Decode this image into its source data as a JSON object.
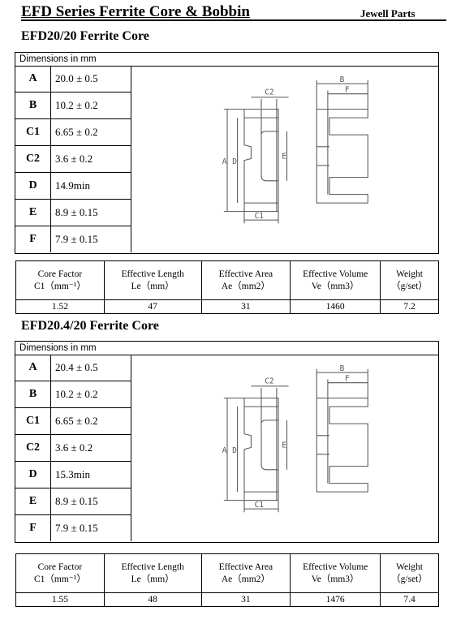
{
  "header": {
    "title": "EFD Series Ferrite Core & Bobbin",
    "brand": "Jewell Parts"
  },
  "sections": [
    {
      "title": "EFD20/20 Ferrite Core",
      "dims_header": "Dimensions in mm",
      "dims": [
        {
          "k": "A",
          "v": "20.0 ± 0.5"
        },
        {
          "k": "B",
          "v": "10.2 ± 0.2"
        },
        {
          "k": "C1",
          "v": "6.65 ± 0.2"
        },
        {
          "k": "C2",
          "v": "3.6 ± 0.2"
        },
        {
          "k": "D",
          "v": "14.9min"
        },
        {
          "k": "E",
          "v": "8.9 ± 0.15"
        },
        {
          "k": "F",
          "v": "7.9 ± 0.15"
        }
      ],
      "props_header": [
        [
          "Core Factor",
          "C1（mm⁻¹）"
        ],
        [
          "Effective Length",
          "Le（mm）"
        ],
        [
          "Effective Area",
          "Ae（mm2）"
        ],
        [
          "Effective Volume",
          "Ve（mm3）"
        ],
        [
          "Weight",
          "（g/set）"
        ]
      ],
      "props_values": [
        "1.52",
        "47",
        "31",
        "1460",
        "7.2"
      ]
    },
    {
      "title": "EFD20.4/20 Ferrite Core",
      "dims_header": "Dimensions in mm",
      "dims": [
        {
          "k": "A",
          "v": "20.4 ± 0.5"
        },
        {
          "k": "B",
          "v": "10.2 ± 0.2"
        },
        {
          "k": "C1",
          "v": "6.65 ± 0.2"
        },
        {
          "k": "C2",
          "v": "3.6 ± 0.2"
        },
        {
          "k": "D",
          "v": "15.3min"
        },
        {
          "k": "E",
          "v": "8.9 ± 0.15"
        },
        {
          "k": "F",
          "v": "7.9 ± 0.15"
        }
      ],
      "props_header": [
        [
          "Core Factor",
          "C1（mm⁻¹）"
        ],
        [
          "Effective Length",
          "Le（mm）"
        ],
        [
          "Effective Area",
          "Ae（mm2）"
        ],
        [
          "Effective Volume",
          "Ve（mm3）"
        ],
        [
          "Weight",
          "（g/set）"
        ]
      ],
      "props_values": [
        "1.55",
        "48",
        "31",
        "1476",
        "7.4"
      ]
    }
  ],
  "drawing_labels": {
    "A": "A",
    "B": "B",
    "C1": "C1",
    "C2": "C2",
    "D": "D",
    "E": "E",
    "F": "F"
  }
}
